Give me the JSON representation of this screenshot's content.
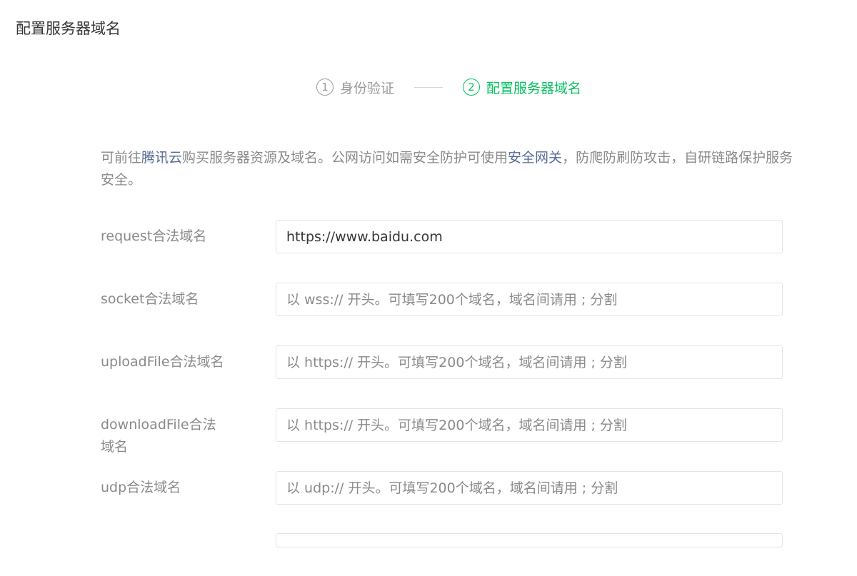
{
  "page": {
    "title": "配置服务器域名"
  },
  "steps": [
    {
      "number": "1",
      "label": "身份验证",
      "active": false
    },
    {
      "number": "2",
      "label": "配置服务器域名",
      "active": true
    }
  ],
  "intro": {
    "text_before": "可前往",
    "link1": "腾讯云",
    "text_middle": "购买服务器资源及域名。公网访问如需安全防护可使用",
    "link2": "安全网关",
    "text_after": "，防爬防刷防攻击，自研链路保护服务安全。"
  },
  "form": {
    "request": {
      "label": "request合法域名",
      "value": "https://www.baidu.com",
      "placeholder": ""
    },
    "socket": {
      "label": "socket合法域名",
      "value": "",
      "placeholder": "以 wss:// 开头。可填写200个域名，域名间请用 ; 分割"
    },
    "uploadFile": {
      "label": "uploadFile合法域名",
      "value": "",
      "placeholder": "以 https:// 开头。可填写200个域名，域名间请用 ; 分割"
    },
    "downloadFile": {
      "label": "downloadFile合法域名",
      "value": "",
      "placeholder": "以 https:// 开头。可填写200个域名，域名间请用 ; 分割"
    },
    "udp": {
      "label": "udp合法域名",
      "value": "",
      "placeholder": "以 udp:// 开头。可填写200个域名，域名间请用 ; 分割"
    }
  },
  "colors": {
    "accent": "#07c160",
    "link": "#576b95",
    "muted": "#8a8a8a",
    "border": "#e4e4e4"
  }
}
